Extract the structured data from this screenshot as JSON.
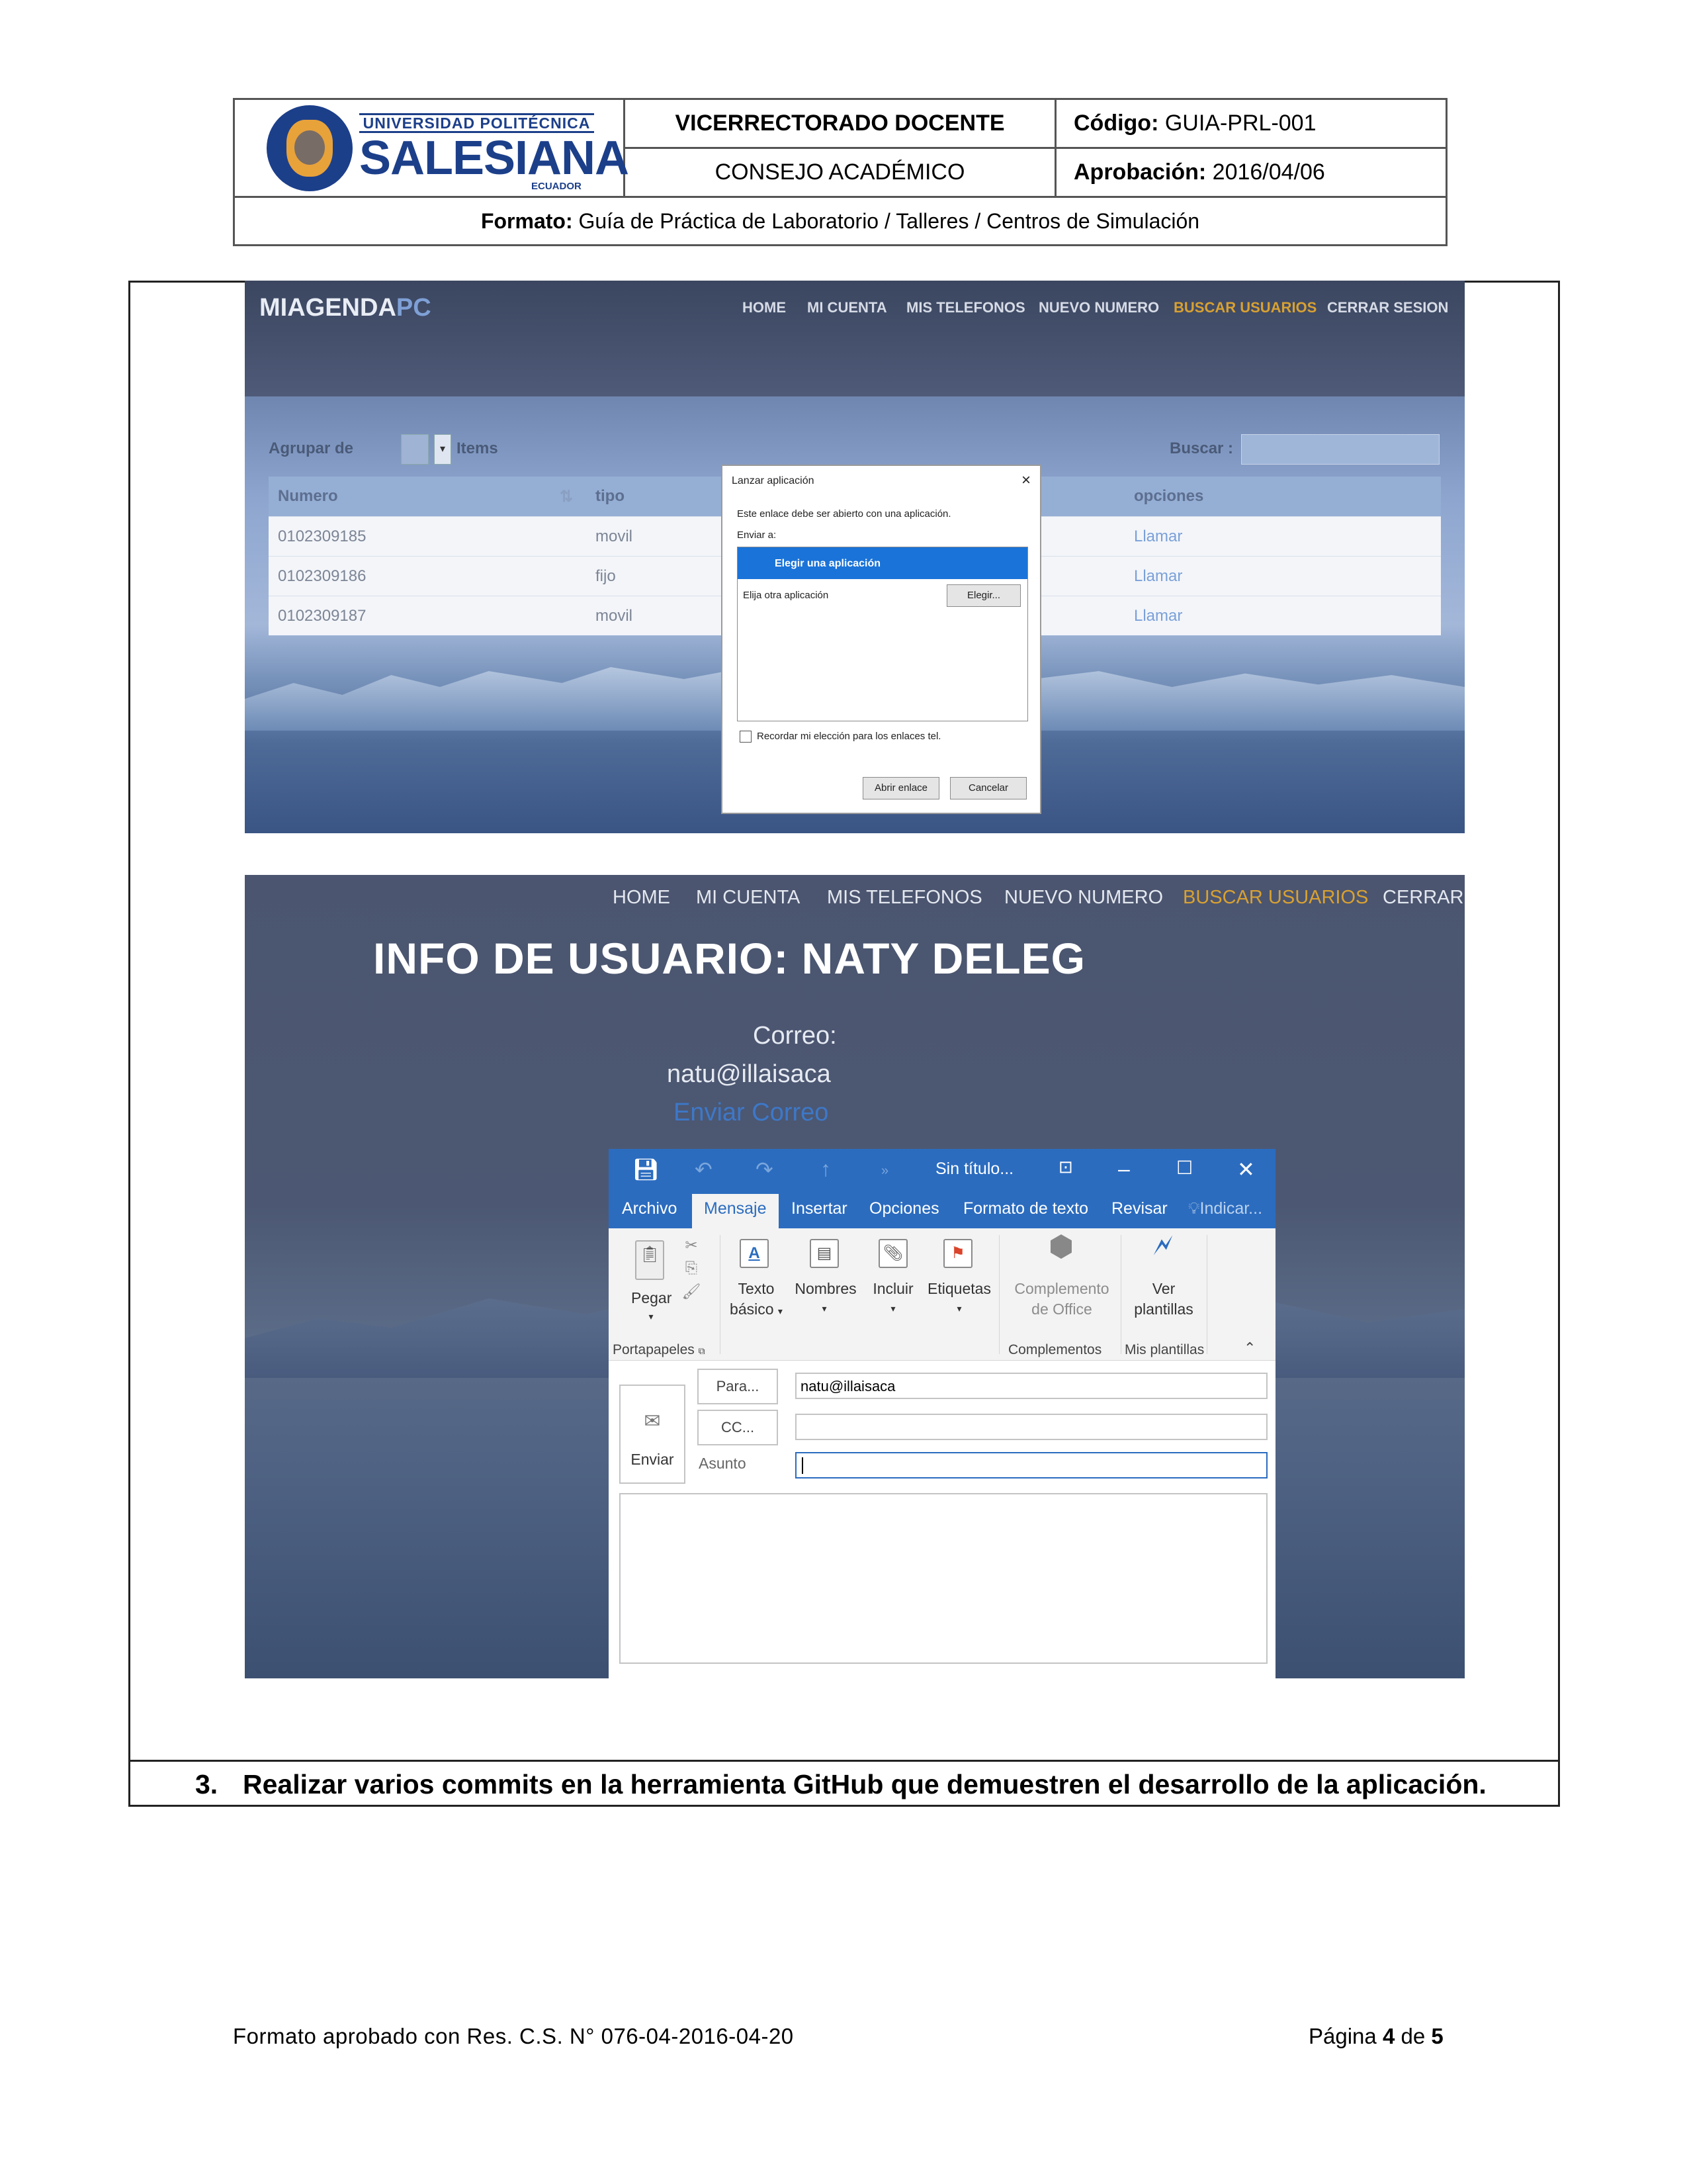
{
  "header": {
    "logo": {
      "top": "UNIVERSIDAD POLITÉCNICA",
      "main": "SALESIANA",
      "sub": "ECUADOR"
    },
    "vicerrectorado": "VICERRECTORADO DOCENTE",
    "consejo": "CONSEJO ACADÉMICO",
    "codigo_label": "Código:",
    "codigo_value": "GUIA-PRL-001",
    "aprobacion_label": "Aprobación:",
    "aprobacion_value": "2016/04/06",
    "formato_label": "Formato:",
    "formato_value": "Guía de Práctica de Laboratorio / Talleres / Centros de Simulación"
  },
  "screenshot1": {
    "brand_a": "MIAGENDA",
    "brand_b": "PC",
    "nav": [
      "HOME",
      "MI CUENTA",
      "MIS TELEFONOS",
      "NUEVO NUMERO",
      "BUSCAR USUARIOS",
      "CERRAR SESION"
    ],
    "group_label": "Agrupar de",
    "items_label": "Items",
    "search_label": "Buscar :",
    "columns": [
      "Numero",
      "tipo",
      "opciones"
    ],
    "rows": [
      {
        "numero": "0102309185",
        "tipo": "movil",
        "accion": "Llamar"
      },
      {
        "numero": "0102309186",
        "tipo": "fijo",
        "accion": "Llamar"
      },
      {
        "numero": "0102309187",
        "tipo": "movil",
        "accion": "Llamar"
      }
    ],
    "dialog": {
      "title": "Lanzar aplicación",
      "close": "×",
      "message": "Este enlace debe ser abierto con una aplicación.",
      "send_to": "Enviar a:",
      "option_selected": "Elegir una aplicación",
      "option_other": "Elija otra aplicación",
      "choose_button": "Elegir...",
      "remember": "Recordar mi elección para los enlaces tel.",
      "open_button": "Abrir enlace",
      "cancel_button": "Cancelar"
    }
  },
  "screenshot2": {
    "nav": [
      "HOME",
      "MI CUENTA",
      "MIS TELEFONOS",
      "NUEVO NUMERO",
      "BUSCAR USUARIOS",
      "CERRAR"
    ],
    "title": "INFO DE USUARIO: NATY DELEG",
    "correo_label": "Correo:",
    "correo_value": "natu@illaisaca",
    "send_link": "Enviar Correo",
    "outlook": {
      "window_title": "Sin título...",
      "tabs": [
        "Archivo",
        "Mensaje",
        "Insertar",
        "Opciones",
        "Formato de texto",
        "Revisar",
        "Indicar..."
      ],
      "ribbon": {
        "pegar": "Pegar",
        "texto_basico_1": "Texto",
        "texto_basico_2": "básico",
        "nombres": "Nombres",
        "incluir": "Incluir",
        "etiquetas": "Etiquetas",
        "complemento_1": "Complemento",
        "complemento_2": "de Office",
        "ver_1": "Ver",
        "ver_2": "plantillas",
        "group_portapapeles": "Portapapeles",
        "group_complementos": "Complementos",
        "group_plantillas": "Mis plantillas"
      },
      "enviar": "Enviar",
      "para_button": "Para...",
      "cc_button": "CC...",
      "asunto_label": "Asunto",
      "para_value": "natu@illaisaca",
      "cc_value": "",
      "asunto_value": ""
    }
  },
  "step": {
    "number": "3.",
    "text": "Realizar varios commits en la herramienta GitHub que demuestren el desarrollo de la aplicación."
  },
  "footer": {
    "left": "Formato aprobado con Res. C.S. N° 076-04-2016-04-20",
    "page_label": "Página",
    "page_current": "4",
    "page_of": "de",
    "page_total": "5"
  }
}
